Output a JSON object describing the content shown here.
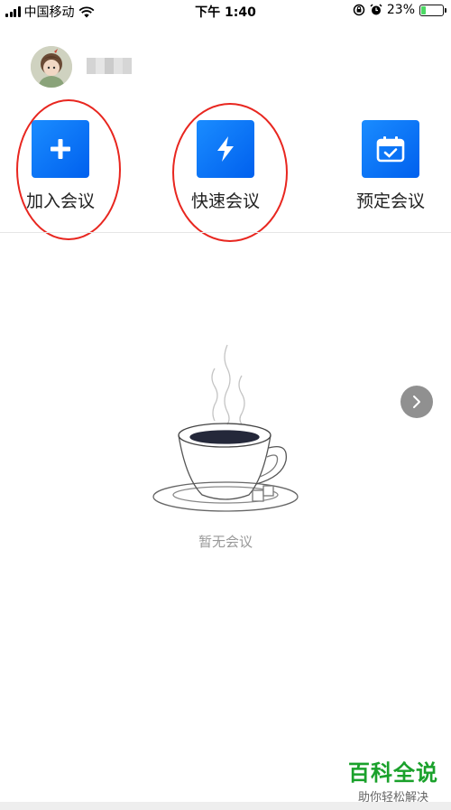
{
  "status_bar": {
    "carrier": "中国移动",
    "time": "下午 1:40",
    "battery_percent": "23%",
    "battery_level": 0.23,
    "icons": [
      "signal-icon",
      "wifi-icon",
      "rotation-lock-icon",
      "alarm-icon",
      "battery-icon"
    ]
  },
  "profile": {
    "avatar": "avatar",
    "username": ""
  },
  "actions": [
    {
      "label": "加入会议",
      "icon": "plus-icon",
      "circled": true
    },
    {
      "label": "快速会议",
      "icon": "lightning-icon",
      "circled": true
    },
    {
      "label": "预定会议",
      "icon": "calendar-check-icon",
      "circled": false
    }
  ],
  "colors": {
    "accent": "#0a78ff",
    "annotation_ring": "#e8261f",
    "watermark": "#1aa12b"
  },
  "empty_state": {
    "text": "暂无会议",
    "illustration": "coffee-cup-illustration"
  },
  "side_button": {
    "icon": "chevron-right-icon"
  },
  "watermark": {
    "title": "百科全说",
    "subtitle": "助你轻松解决"
  }
}
